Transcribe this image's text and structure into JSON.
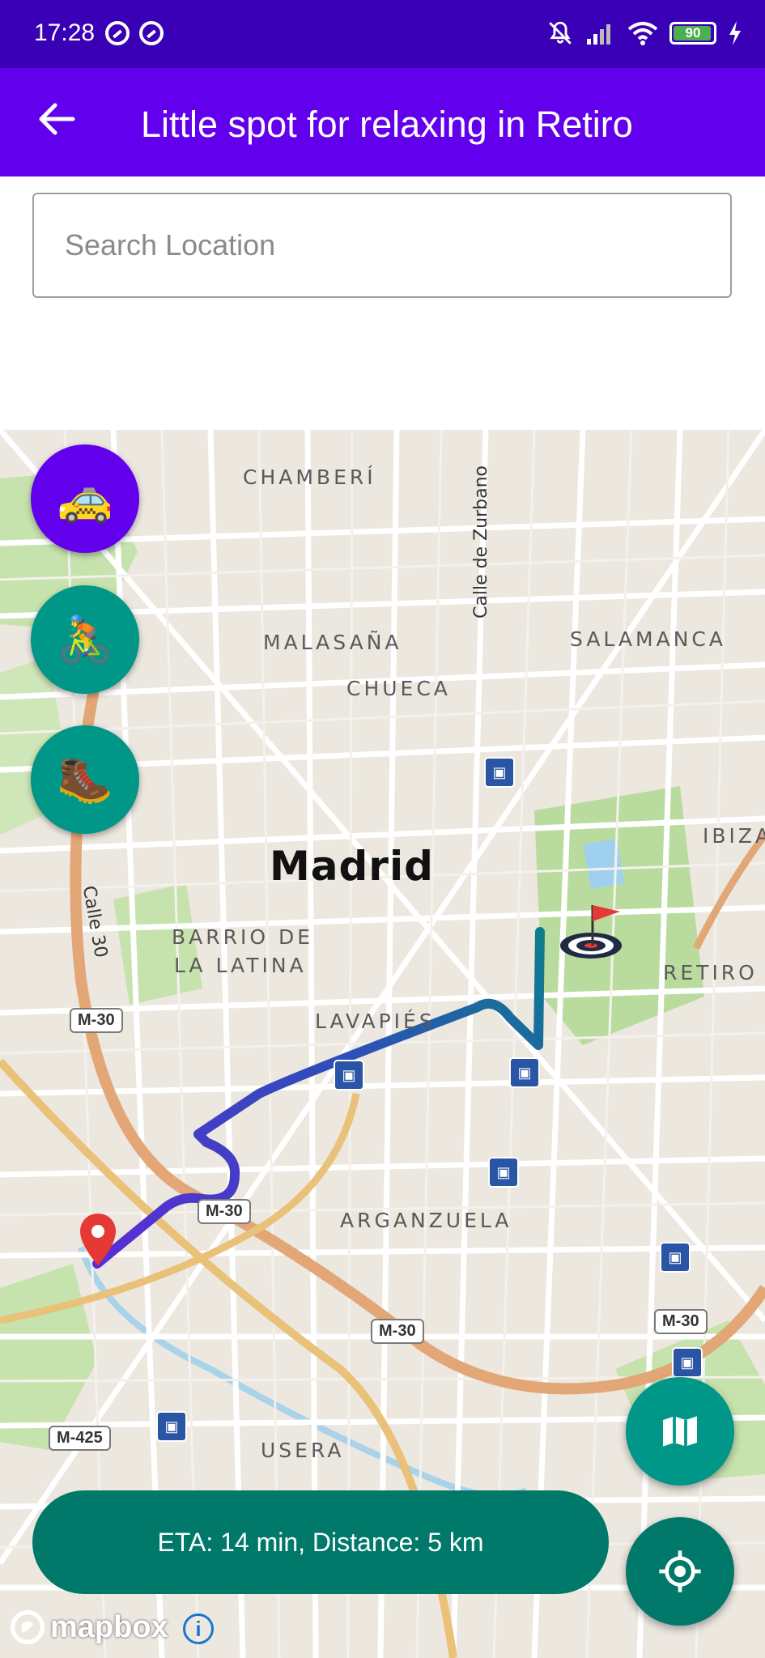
{
  "status": {
    "time": "17:28",
    "battery": "90"
  },
  "appbar": {
    "title": "Little spot for relaxing in Retiro"
  },
  "search": {
    "placeholder": "Search Location",
    "value": ""
  },
  "map": {
    "places": {
      "chamberi": "CHAMBERÍ",
      "malasana": "MALASAÑA",
      "salamanca": "SALAMANCA",
      "chueca": "CHUECA",
      "ibiza": "IBIZA",
      "madrid": "Madrid",
      "barrio_latina_1": "BARRIO DE",
      "barrio_latina_2": "LA LATINA",
      "retiro": "RETIRO",
      "lavapies": "LAVAPIÉS",
      "arganzuela": "ARGANZUELA",
      "usera": "USERA"
    },
    "streets": {
      "zurbano": "Calle de Zurbano",
      "calle30": "Calle 30"
    },
    "shields": {
      "m30_a": "M-30",
      "m30_b": "M-30",
      "m30_c": "M-30",
      "m30_d": "M-30",
      "m425": "M-425"
    },
    "route_color_start": "#5b2cd6",
    "route_color_end": "#0e7f8a"
  },
  "modes": {
    "car": {
      "icon": "🚕",
      "color": "#6200ee"
    },
    "bike": {
      "icon": "🚴",
      "color": "#009688"
    },
    "walk": {
      "icon": "🥾",
      "color": "#009688"
    }
  },
  "eta": {
    "text": "ETA: 14 min, Distance: 5 km"
  },
  "attribution": {
    "logo": "mapbox",
    "info": "i"
  }
}
